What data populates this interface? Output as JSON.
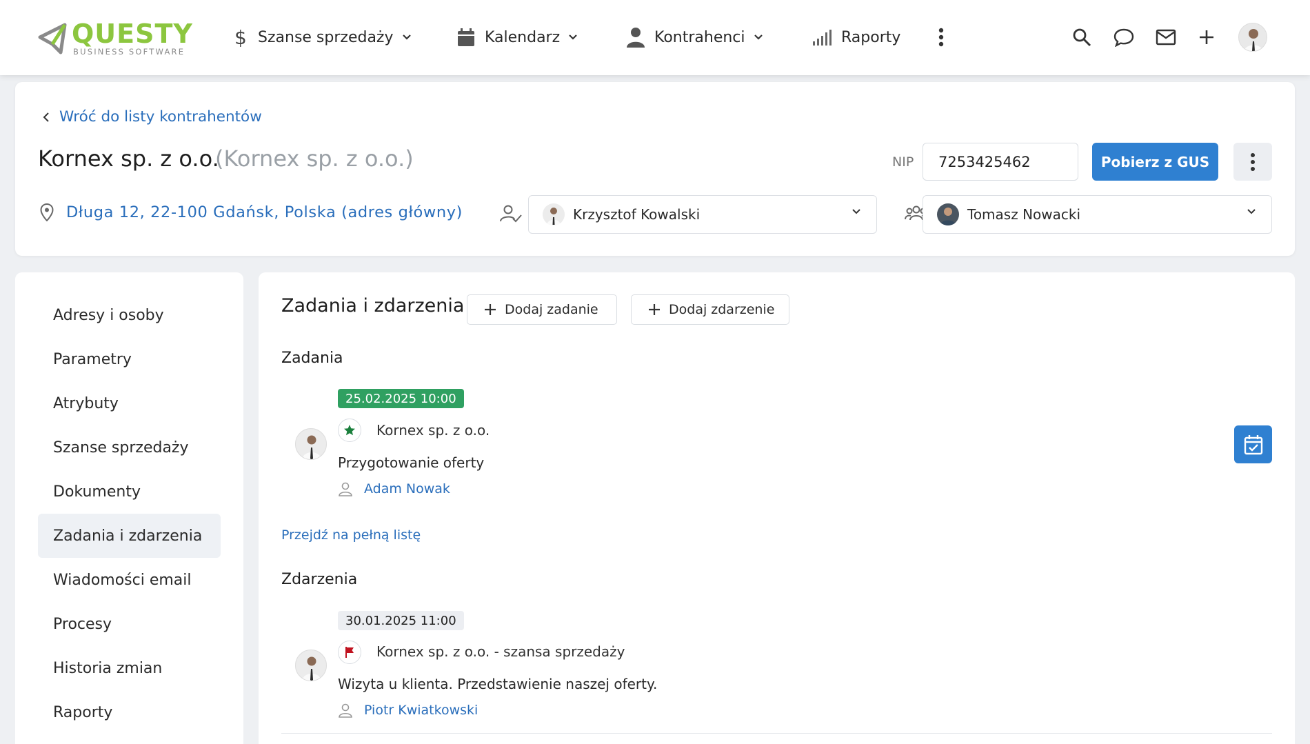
{
  "topbar": {
    "logo_main": "QUESTY",
    "logo_sub": "BUSINESS SOFTWARE",
    "nav": [
      {
        "label": "Szanse sprzedaży",
        "icon": "dollar-icon"
      },
      {
        "label": "Kalendarz",
        "icon": "calendar-icon"
      },
      {
        "label": "Kontrahenci",
        "icon": "person-icon"
      },
      {
        "label": "Raporty",
        "icon": "signal-bars-icon"
      }
    ],
    "icons": [
      "search-icon",
      "chat-icon",
      "mail-icon",
      "plus-icon"
    ]
  },
  "header": {
    "back_label": "Wróć do listy kontrahentów",
    "company_name": "Kornex sp. z o.o.",
    "company_alt": "(Kornex sp. z o.o.)",
    "nip_label": "NIP",
    "nip_value": "7253425462",
    "gus_button": "Pobierz z GUS",
    "address": "Długa 12, 22-100 Gdańsk, Polska (adres główny)",
    "owner": "Krzysztof Kowalski",
    "team_member": "Tomasz Nowacki"
  },
  "sidebar": {
    "items": [
      {
        "label": "Adresy i osoby"
      },
      {
        "label": "Parametry"
      },
      {
        "label": "Atrybuty"
      },
      {
        "label": "Szanse sprzedaży"
      },
      {
        "label": "Dokumenty"
      },
      {
        "label": "Zadania i zdarzenia",
        "active": true
      },
      {
        "label": "Wiadomości email"
      },
      {
        "label": "Procesy"
      },
      {
        "label": "Historia zmian"
      },
      {
        "label": "Raporty"
      }
    ]
  },
  "main": {
    "title": "Zadania i zdarzenia",
    "add_task": "Dodaj zadanie",
    "add_event": "Dodaj zdarzenie",
    "tasks_title": "Zadania",
    "task": {
      "date": "25.02.2025 10:00",
      "title": "Kornex sp. z o.o.",
      "description": "Przygotowanie oferty",
      "person": "Adam Nowak",
      "badge_color": "#2fa061"
    },
    "full_list": "Przejdź na pełną listę",
    "events_title": "Zdarzenia",
    "event": {
      "date": "30.01.2025 11:00",
      "title": "Kornex sp. z o.o. - szansa sprzedaży",
      "description": "Wizyta u klienta. Przedstawienie naszej oferty.",
      "person": "Piotr Kwiatkowski"
    }
  },
  "colors": {
    "accent": "#2f80d1",
    "link": "#2a6ebb",
    "logo_green": "#8cc63f"
  }
}
